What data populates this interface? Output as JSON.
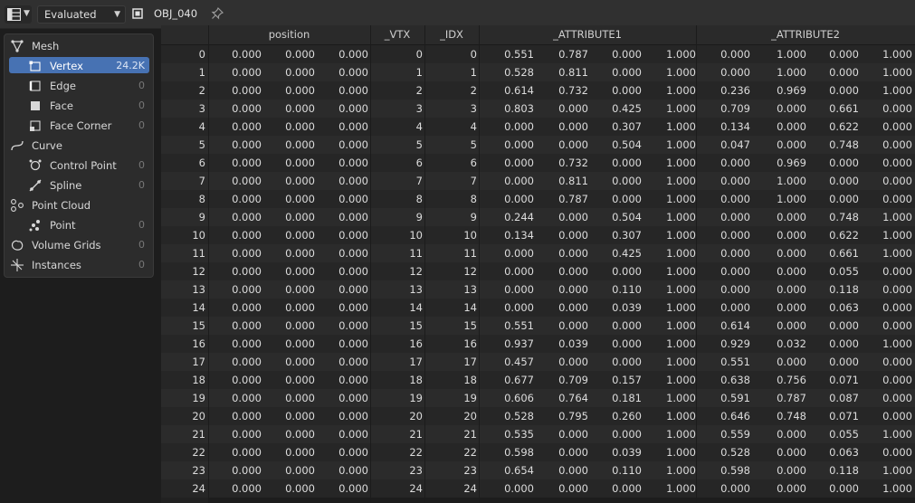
{
  "header": {
    "mode": "Evaluated",
    "object_name": "OBJ_040",
    "icons": [
      "spreadsheet-icon",
      "chevron-down-icon",
      "mesh-object-icon",
      "pin-icon"
    ]
  },
  "sidebar": {
    "items": [
      {
        "name": "mesh",
        "label": "Mesh",
        "count": "",
        "icon": "mesh-icon",
        "level": 0
      },
      {
        "name": "vertex",
        "label": "Vertex",
        "count": "24.2K",
        "icon": "vertex-icon",
        "level": 1,
        "active": true
      },
      {
        "name": "edge",
        "label": "Edge",
        "count": "0",
        "icon": "edge-icon",
        "level": 1
      },
      {
        "name": "face",
        "label": "Face",
        "count": "0",
        "icon": "face-icon",
        "level": 1
      },
      {
        "name": "face-corner",
        "label": "Face Corner",
        "count": "0",
        "icon": "face-corner-icon",
        "level": 1
      },
      {
        "name": "curve",
        "label": "Curve",
        "count": "",
        "icon": "curve-icon",
        "level": 0
      },
      {
        "name": "control-point",
        "label": "Control Point",
        "count": "0",
        "icon": "control-point-icon",
        "level": 1
      },
      {
        "name": "spline",
        "label": "Spline",
        "count": "0",
        "icon": "spline-icon",
        "level": 1
      },
      {
        "name": "point-cloud",
        "label": "Point Cloud",
        "count": "",
        "icon": "point-cloud-icon",
        "level": 0
      },
      {
        "name": "point",
        "label": "Point",
        "count": "0",
        "icon": "point-icon",
        "level": 1
      },
      {
        "name": "volume-grids",
        "label": "Volume Grids",
        "count": "0",
        "icon": "volume-icon",
        "level": 0
      },
      {
        "name": "instances",
        "label": "Instances",
        "count": "0",
        "icon": "instances-icon",
        "level": 0
      }
    ]
  },
  "spreadsheet": {
    "columns": [
      {
        "label": "position",
        "span": 3
      },
      {
        "label": "_VTX",
        "span": 1
      },
      {
        "label": "_IDX",
        "span": 1
      },
      {
        "label": "_ATTRIBUTE1",
        "span": 4
      },
      {
        "label": "_ATTRIBUTE2",
        "span": 4
      }
    ],
    "rows": [
      [
        "0",
        "0.000",
        "0.000",
        "0.000",
        "0",
        "0",
        "0.551",
        "0.787",
        "0.000",
        "1.000",
        "0.000",
        "1.000",
        "0.000",
        "1.000"
      ],
      [
        "1",
        "0.000",
        "0.000",
        "0.000",
        "1",
        "1",
        "0.528",
        "0.811",
        "0.000",
        "1.000",
        "0.000",
        "1.000",
        "0.000",
        "1.000"
      ],
      [
        "2",
        "0.000",
        "0.000",
        "0.000",
        "2",
        "2",
        "0.614",
        "0.732",
        "0.000",
        "1.000",
        "0.236",
        "0.969",
        "0.000",
        "1.000"
      ],
      [
        "3",
        "0.000",
        "0.000",
        "0.000",
        "3",
        "3",
        "0.803",
        "0.000",
        "0.425",
        "1.000",
        "0.709",
        "0.000",
        "0.661",
        "0.000"
      ],
      [
        "4",
        "0.000",
        "0.000",
        "0.000",
        "4",
        "4",
        "0.000",
        "0.000",
        "0.307",
        "1.000",
        "0.134",
        "0.000",
        "0.622",
        "0.000"
      ],
      [
        "5",
        "0.000",
        "0.000",
        "0.000",
        "5",
        "5",
        "0.000",
        "0.000",
        "0.504",
        "1.000",
        "0.047",
        "0.000",
        "0.748",
        "0.000"
      ],
      [
        "6",
        "0.000",
        "0.000",
        "0.000",
        "6",
        "6",
        "0.000",
        "0.732",
        "0.000",
        "1.000",
        "0.000",
        "0.969",
        "0.000",
        "0.000"
      ],
      [
        "7",
        "0.000",
        "0.000",
        "0.000",
        "7",
        "7",
        "0.000",
        "0.811",
        "0.000",
        "1.000",
        "0.000",
        "1.000",
        "0.000",
        "0.000"
      ],
      [
        "8",
        "0.000",
        "0.000",
        "0.000",
        "8",
        "8",
        "0.000",
        "0.787",
        "0.000",
        "1.000",
        "0.000",
        "1.000",
        "0.000",
        "0.000"
      ],
      [
        "9",
        "0.000",
        "0.000",
        "0.000",
        "9",
        "9",
        "0.244",
        "0.000",
        "0.504",
        "1.000",
        "0.000",
        "0.000",
        "0.748",
        "1.000"
      ],
      [
        "10",
        "0.000",
        "0.000",
        "0.000",
        "10",
        "10",
        "0.134",
        "0.000",
        "0.307",
        "1.000",
        "0.000",
        "0.000",
        "0.622",
        "1.000"
      ],
      [
        "11",
        "0.000",
        "0.000",
        "0.000",
        "11",
        "11",
        "0.000",
        "0.000",
        "0.425",
        "1.000",
        "0.000",
        "0.000",
        "0.661",
        "1.000"
      ],
      [
        "12",
        "0.000",
        "0.000",
        "0.000",
        "12",
        "12",
        "0.000",
        "0.000",
        "0.000",
        "1.000",
        "0.000",
        "0.000",
        "0.055",
        "0.000"
      ],
      [
        "13",
        "0.000",
        "0.000",
        "0.000",
        "13",
        "13",
        "0.000",
        "0.000",
        "0.110",
        "1.000",
        "0.000",
        "0.000",
        "0.118",
        "0.000"
      ],
      [
        "14",
        "0.000",
        "0.000",
        "0.000",
        "14",
        "14",
        "0.000",
        "0.000",
        "0.039",
        "1.000",
        "0.000",
        "0.000",
        "0.063",
        "0.000"
      ],
      [
        "15",
        "0.000",
        "0.000",
        "0.000",
        "15",
        "15",
        "0.551",
        "0.000",
        "0.000",
        "1.000",
        "0.614",
        "0.000",
        "0.000",
        "0.000"
      ],
      [
        "16",
        "0.000",
        "0.000",
        "0.000",
        "16",
        "16",
        "0.937",
        "0.039",
        "0.000",
        "1.000",
        "0.929",
        "0.032",
        "0.000",
        "1.000"
      ],
      [
        "17",
        "0.000",
        "0.000",
        "0.000",
        "17",
        "17",
        "0.457",
        "0.000",
        "0.000",
        "1.000",
        "0.551",
        "0.000",
        "0.000",
        "0.000"
      ],
      [
        "18",
        "0.000",
        "0.000",
        "0.000",
        "18",
        "18",
        "0.677",
        "0.709",
        "0.157",
        "1.000",
        "0.638",
        "0.756",
        "0.071",
        "0.000"
      ],
      [
        "19",
        "0.000",
        "0.000",
        "0.000",
        "19",
        "19",
        "0.606",
        "0.764",
        "0.181",
        "1.000",
        "0.591",
        "0.787",
        "0.087",
        "0.000"
      ],
      [
        "20",
        "0.000",
        "0.000",
        "0.000",
        "20",
        "20",
        "0.528",
        "0.795",
        "0.260",
        "1.000",
        "0.646",
        "0.748",
        "0.071",
        "0.000"
      ],
      [
        "21",
        "0.000",
        "0.000",
        "0.000",
        "21",
        "21",
        "0.535",
        "0.000",
        "0.000",
        "1.000",
        "0.559",
        "0.000",
        "0.055",
        "1.000"
      ],
      [
        "22",
        "0.000",
        "0.000",
        "0.000",
        "22",
        "22",
        "0.598",
        "0.000",
        "0.039",
        "1.000",
        "0.528",
        "0.000",
        "0.063",
        "0.000"
      ],
      [
        "23",
        "0.000",
        "0.000",
        "0.000",
        "23",
        "23",
        "0.654",
        "0.000",
        "0.110",
        "1.000",
        "0.598",
        "0.000",
        "0.118",
        "1.000"
      ],
      [
        "24",
        "0.000",
        "0.000",
        "0.000",
        "24",
        "24",
        "0.000",
        "0.000",
        "0.000",
        "1.000",
        "0.000",
        "0.000",
        "0.000",
        "1.000"
      ]
    ]
  },
  "colors": {
    "accent": "#4772b3",
    "header_bg": "#303030",
    "panel_bg": "#2c2c2c",
    "row_even": "#262626",
    "row_odd": "#2b2b2b"
  }
}
